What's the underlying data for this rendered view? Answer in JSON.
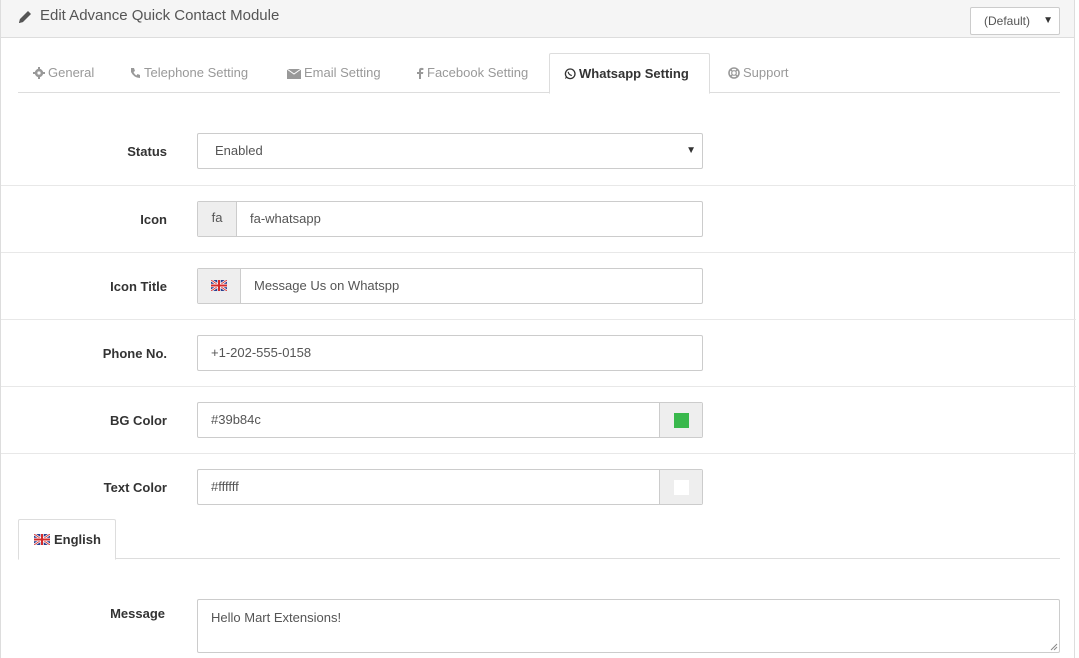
{
  "header": {
    "title": "Edit Advance Quick Contact Module",
    "icon": "pencil-icon",
    "store_select": "(Default)"
  },
  "tabs": [
    {
      "label": "General",
      "icon": "gear-icon"
    },
    {
      "label": "Telephone Setting",
      "icon": "phone-icon"
    },
    {
      "label": "Email Setting",
      "icon": "envelope-icon"
    },
    {
      "label": "Facebook Setting",
      "icon": "facebook-icon"
    },
    {
      "label": "Whatsapp Setting",
      "icon": "whatsapp-icon",
      "active": true
    },
    {
      "label": "Support",
      "icon": "lifebuoy-icon"
    }
  ],
  "form": {
    "status": {
      "label": "Status",
      "value": "Enabled"
    },
    "icon": {
      "label": "Icon",
      "prefix": "fa",
      "value": "fa-whatsapp"
    },
    "icon_title": {
      "label": "Icon Title",
      "value": "Message Us on Whatspp"
    },
    "phone": {
      "label": "Phone No.",
      "value": "+1-202-555-0158"
    },
    "bg_color": {
      "label": "BG Color",
      "value": "#39b84c",
      "swatch": "#39b84c"
    },
    "text_color": {
      "label": "Text Color",
      "value": "#ffffff",
      "swatch": "#ffffff"
    }
  },
  "language_tab": {
    "label": "English",
    "icon": "uk-flag-icon"
  },
  "message": {
    "label": "Message",
    "value": "Hello Mart Extensions!"
  }
}
